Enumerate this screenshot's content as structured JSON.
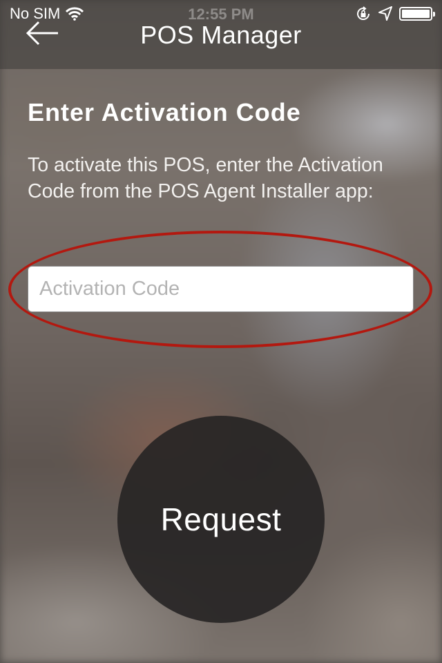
{
  "status_bar": {
    "carrier": "No SIM",
    "time": "12:55 PM",
    "icons": [
      "wifi-icon",
      "rotation-lock-icon",
      "location-icon",
      "battery-icon"
    ]
  },
  "nav": {
    "title": "POS Manager",
    "back_icon": "arrow-left-icon"
  },
  "main": {
    "heading": "Enter Activation Code",
    "instructions": "To activate this POS, enter the Activation Code from the POS Agent Installer app:",
    "activation_input": {
      "value": "",
      "placeholder": "Activation Code"
    },
    "request_label": "Request"
  },
  "colors": {
    "highlight_ring": "#b3180f",
    "button_bg": "#262423"
  }
}
